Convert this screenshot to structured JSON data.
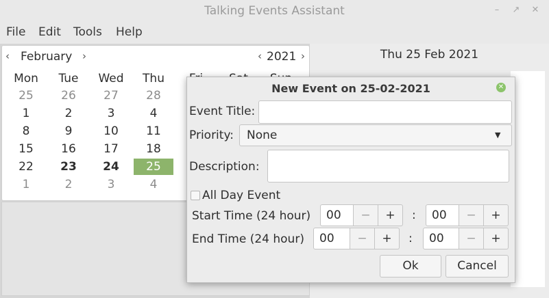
{
  "window": {
    "title": "Talking Events Assistant"
  },
  "menubar": [
    "File",
    "Edit",
    "Tools",
    "Help"
  ],
  "calendar": {
    "month": "February",
    "year": "2021",
    "weekdays": [
      "Mon",
      "Tue",
      "Wed",
      "Thu",
      "Fri",
      "Sat",
      "Sun"
    ],
    "weeks": [
      [
        "25",
        "26",
        "27",
        "28"
      ],
      [
        "1",
        "2",
        "3",
        "4"
      ],
      [
        "8",
        "9",
        "10",
        "11"
      ],
      [
        "15",
        "16",
        "17",
        "18"
      ],
      [
        "22",
        "23",
        "24",
        "25"
      ],
      [
        "1",
        "2",
        "3",
        "4"
      ]
    ]
  },
  "right_pane": {
    "date_label": "Thu 25 Feb 2021"
  },
  "dialog": {
    "title": "New Event on 25-02-2021",
    "event_title_label": "Event Title:",
    "event_title_value": "",
    "priority_label": "Priority:",
    "priority_value": "None",
    "description_label": "Description:",
    "description_value": "",
    "all_day_label": "All Day Event",
    "all_day_checked": false,
    "start_label": "Start Time (24 hour)",
    "start_hour": "00",
    "start_minute": "00",
    "end_label": "End Time (24 hour)",
    "end_hour": "00",
    "end_minute": "00",
    "minus": "−",
    "plus": "+",
    "colon": ":",
    "ok": "Ok",
    "cancel": "Cancel"
  }
}
